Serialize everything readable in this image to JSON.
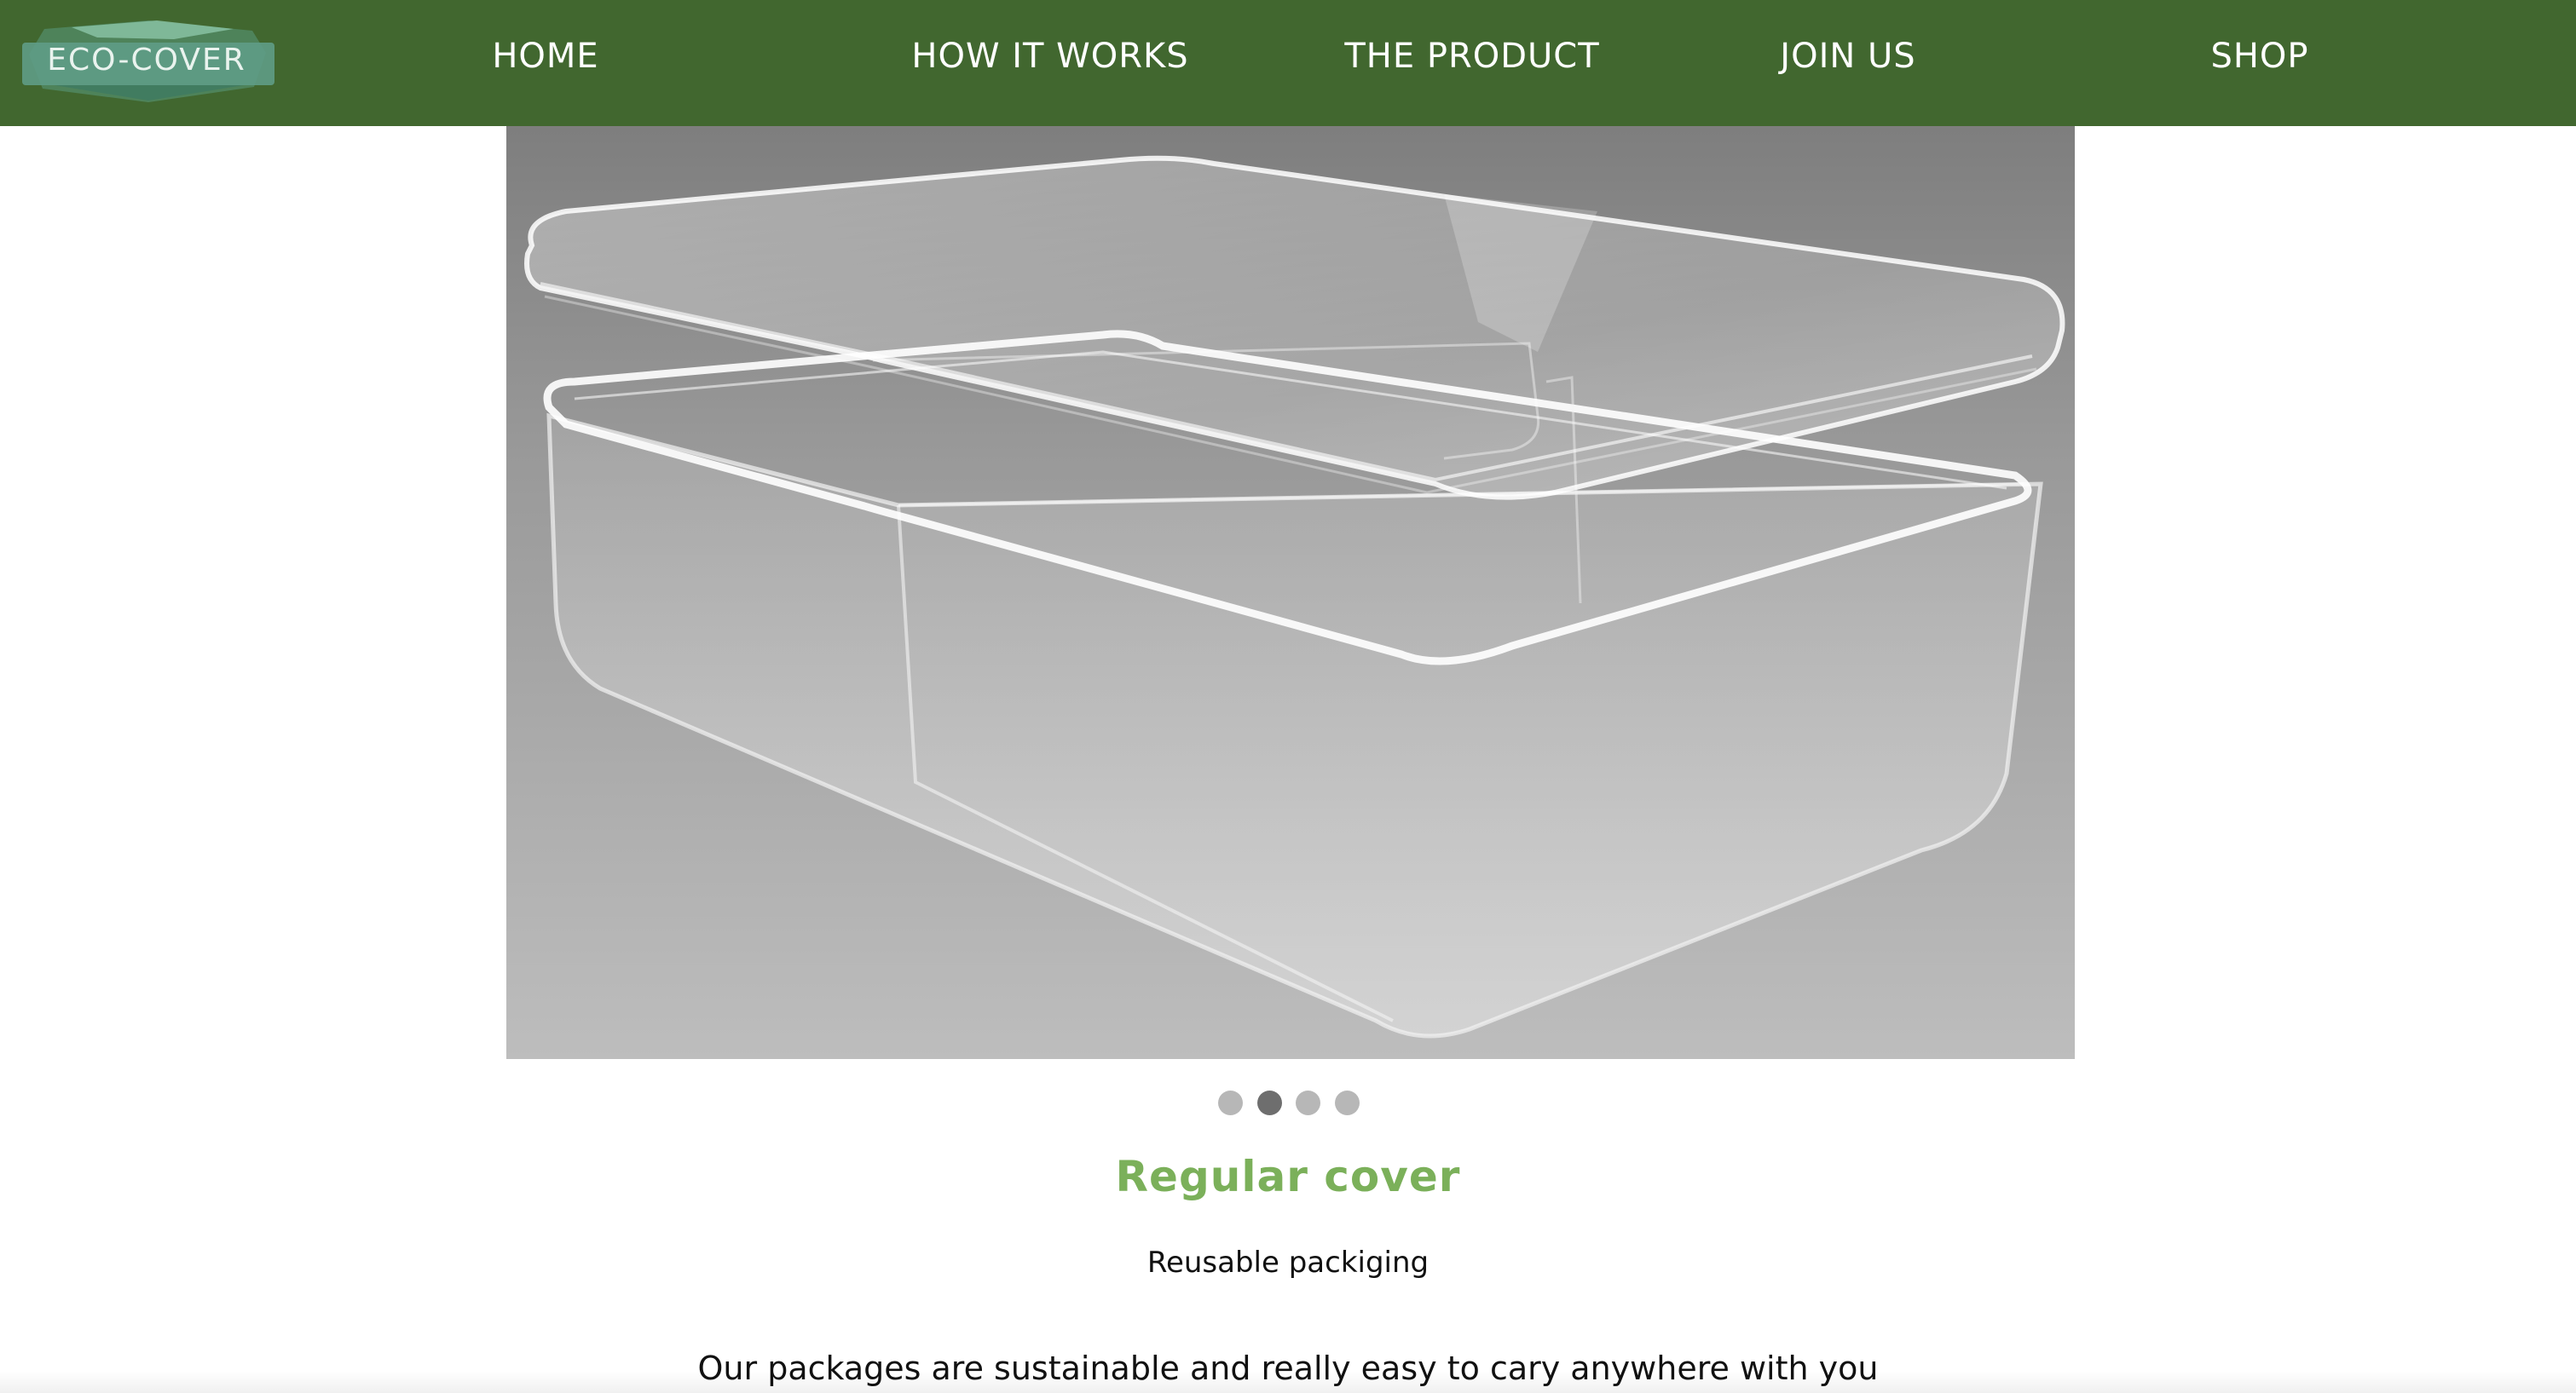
{
  "header": {
    "logo_text": "ECO-COVeR",
    "nav": {
      "home": "HOME",
      "how_it_works": "HOW IT WORKS",
      "the_product": "THE PRODUCT",
      "join_us": "JOIN US",
      "shop": "SHOP"
    }
  },
  "carousel": {
    "image_icon": "clear-plastic-box-image",
    "slide_count": 4,
    "active_slide": 2
  },
  "content": {
    "title": "Regular cover",
    "subtitle": "Reusable packiging",
    "description": "Our packages are sustainable and really easy to cary anywhere with you"
  },
  "colors": {
    "nav_bg": "#41672f",
    "title_green": "#7bb05a",
    "dot_inactive": "#b7b7b7",
    "dot_active": "#6e6e6e"
  }
}
